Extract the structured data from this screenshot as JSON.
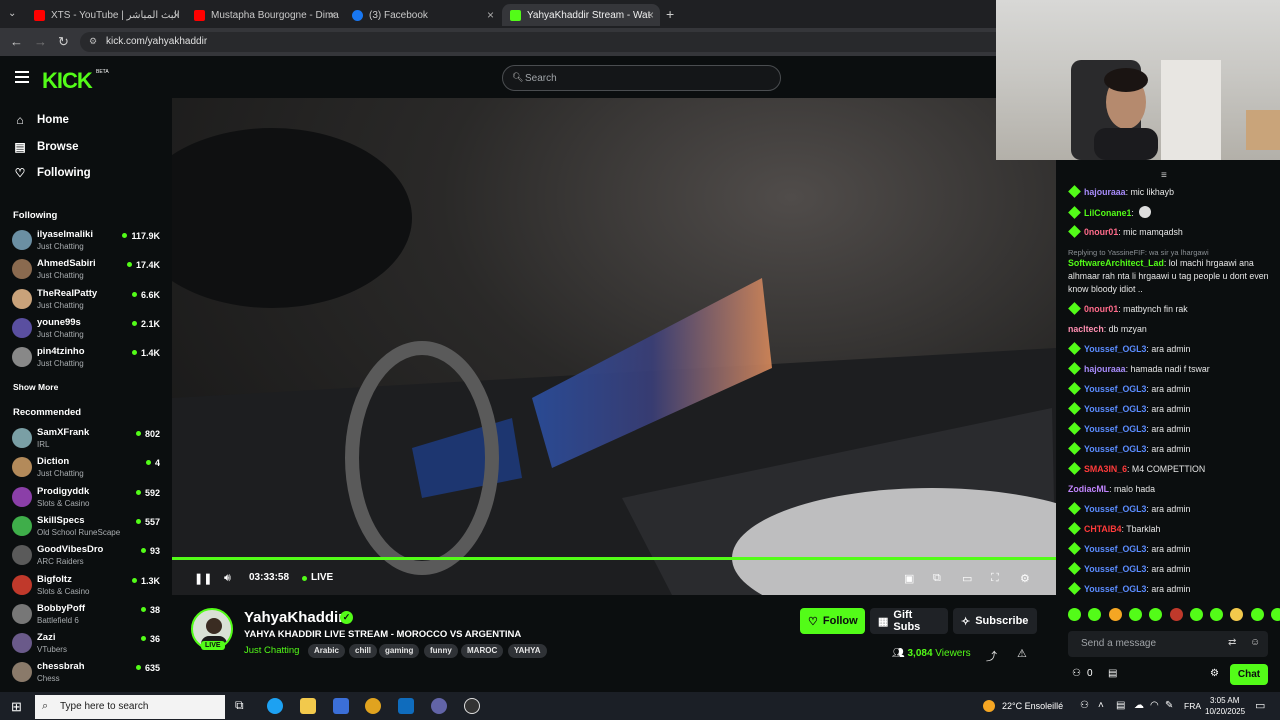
{
  "browser": {
    "tabs": [
      {
        "label": "XTS - YouTube | البث المباشر"
      },
      {
        "label": "Mustapha Bourgogne - Dima M"
      },
      {
        "label": "(3) Facebook"
      },
      {
        "label": "YahyaKhaddir Stream - Wat"
      }
    ],
    "url": "kick.com/yahyakhaddir"
  },
  "header": {
    "logo": "KICK",
    "beta": "BETA",
    "search_placeholder": "Search"
  },
  "sidebar": {
    "nav": [
      {
        "label": "Home",
        "icon": "home-icon"
      },
      {
        "label": "Browse",
        "icon": "browse-icon"
      },
      {
        "label": "Following",
        "icon": "heart-icon"
      }
    ],
    "following_title": "Following",
    "following": [
      {
        "name": "ilyaselmaliki",
        "category": "Just Chatting",
        "viewers": "117.9K"
      },
      {
        "name": "AhmedSabiri",
        "category": "Just Chatting",
        "viewers": "17.4K"
      },
      {
        "name": "TheRealPatty",
        "category": "Just Chatting",
        "viewers": "6.6K"
      },
      {
        "name": "youne99s",
        "category": "Just Chatting",
        "viewers": "2.1K"
      },
      {
        "name": "pin4tzinho",
        "category": "Just Chatting",
        "viewers": "1.4K"
      }
    ],
    "show_more": "Show More",
    "recommended_title": "Recommended",
    "recommended": [
      {
        "name": "SamXFrank",
        "category": "IRL",
        "viewers": "802"
      },
      {
        "name": "Diction",
        "category": "Just Chatting",
        "viewers": "4"
      },
      {
        "name": "Prodigyddk",
        "category": "Slots & Casino",
        "viewers": "592"
      },
      {
        "name": "SkillSpecs",
        "category": "Old School RuneScape",
        "viewers": "557"
      },
      {
        "name": "GoodVibesDro",
        "category": "ARC Raiders",
        "viewers": "93"
      },
      {
        "name": "Bigfoltz",
        "category": "Slots & Casino",
        "viewers": "1.3K"
      },
      {
        "name": "BobbyPoff",
        "category": "Battlefield 6",
        "viewers": "38"
      },
      {
        "name": "Zazi",
        "category": "VTubers",
        "viewers": "36"
      },
      {
        "name": "chessbrah",
        "category": "Chess",
        "viewers": "635"
      }
    ]
  },
  "player": {
    "time": "03:33:58",
    "live": "LIVE",
    "progress": 1.0
  },
  "stream": {
    "channel": "YahyaKhaddir",
    "live_badge": "LIVE",
    "title": "YAHYA KHADDIR LIVE STREAM -  MOROCCO VS ARGENTINA",
    "category": "Just Chatting",
    "tags": [
      "Arabic",
      "chill",
      "gaming",
      "funny",
      "MAROC",
      "YAHYA"
    ],
    "follow": "Follow",
    "gift_subs": "Gift Subs",
    "subscribe": "Subscribe",
    "viewers_count": "3,084",
    "viewers_label": "Viewers"
  },
  "chat": {
    "messages": [
      {
        "user": "hajouraaa",
        "text": "mic likhayb",
        "color": "#a78bfa",
        "badge": true
      },
      {
        "user": "LilConane1",
        "text": "",
        "color": "#53fc18",
        "badge": true
      },
      {
        "user": "0nour01",
        "text": "mic mamqadsh",
        "color": "#ff6b8a",
        "badge": true
      },
      {
        "reply": "Replying to YassineFIF: wa sir ya lhargawi"
      },
      {
        "user": "SoftwareArchitect_Lad",
        "text": "lol machi hrgaawi ana alhmaar rah nta li hrgaawi u tag people u dont even know bloody idiot ..",
        "color": "#53fc18",
        "badge": false
      },
      {
        "user": "0nour01",
        "text": "matbynch fin rak",
        "color": "#ff6b8a",
        "badge": true
      },
      {
        "user": "nacltech",
        "text": "db mzyan",
        "color": "#ff8fb1",
        "badge": false
      },
      {
        "user": "Youssef_OGL3",
        "text": "ara admin",
        "color": "#5b8cff",
        "badge": true
      },
      {
        "user": "hajouraaa",
        "text": "hamada nadi f tswar",
        "color": "#a78bfa",
        "badge": true
      },
      {
        "user": "Youssef_OGL3",
        "text": "ara admin",
        "color": "#5b8cff",
        "badge": true
      },
      {
        "user": "Youssef_OGL3",
        "text": "ara admin",
        "color": "#5b8cff",
        "badge": true
      },
      {
        "user": "Youssef_OGL3",
        "text": "ara admin",
        "color": "#5b8cff",
        "badge": true
      },
      {
        "user": "Youssef_OGL3",
        "text": "ara admin",
        "color": "#5b8cff",
        "badge": true
      },
      {
        "user": "SMA3IN_6",
        "text": "M4 COMPETTION",
        "color": "#ff3b3b",
        "badge": true
      },
      {
        "user": "ZodiacML",
        "text": "malo hada",
        "color": "#c084fc",
        "badge": false
      },
      {
        "user": "Youssef_OGL3",
        "text": "ara admin",
        "color": "#5b8cff",
        "badge": true
      },
      {
        "user": "CHTAIB4",
        "text": "Tbarklah",
        "color": "#ff3b3b",
        "badge": true
      },
      {
        "user": "Youssef_OGL3",
        "text": "ara admin",
        "color": "#5b8cff",
        "badge": true
      },
      {
        "user": "Youssef_OGL3",
        "text": "ara admin",
        "color": "#5b8cff",
        "badge": true
      },
      {
        "user": "Youssef_OGL3",
        "text": "ara admin",
        "color": "#5b8cff",
        "badge": true
      }
    ],
    "input_placeholder": "Send a message",
    "points": "0",
    "chat_button": "Chat"
  },
  "taskbar": {
    "search_placeholder": "Type here to search",
    "weather": "22°C  Ensoleillé",
    "lang": "FRA",
    "time": "3:05 AM",
    "date": "10/20/2025"
  },
  "colors": {
    "accent": "#53fc18",
    "bg": "#0b0e0f"
  }
}
